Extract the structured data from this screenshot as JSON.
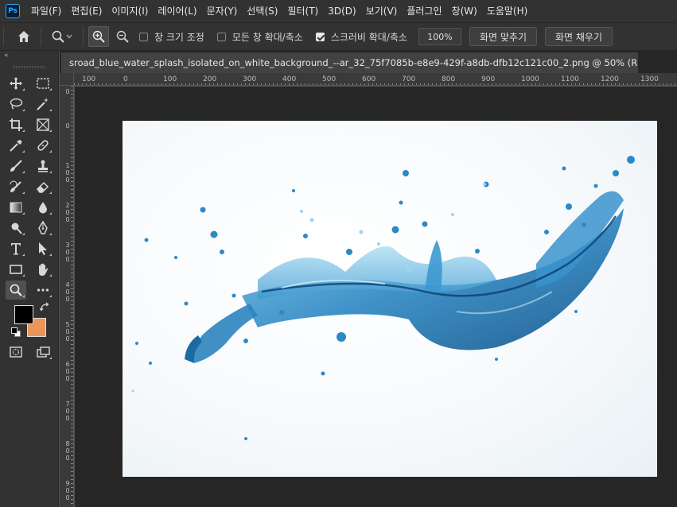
{
  "app": {
    "logo": "Ps"
  },
  "menu": [
    "파일(F)",
    "편집(E)",
    "이미지(I)",
    "레이어(L)",
    "문자(Y)",
    "선택(S)",
    "필터(T)",
    "3D(D)",
    "보기(V)",
    "플러그인",
    "창(W)",
    "도움말(H)"
  ],
  "options": {
    "resize_windows_label": "창 크기 조정",
    "resize_windows_checked": false,
    "zoom_all_label": "모든 창 확대/축소",
    "zoom_all_checked": false,
    "scrubby_zoom_label": "스크러비 확대/축소",
    "scrubby_zoom_checked": true,
    "zoom_value": "100%",
    "fit_screen_label": "화면 맞추기",
    "fill_screen_label": "화면 채우기"
  },
  "document": {
    "tab_title": "sroad_blue_water_splash_isolated_on_white_background_--ar_32_75f7085b-e8e9-429f-a8db-dfb12c121c00_2.png @ 50% (RGB/8#)",
    "close_glyph": "×"
  },
  "rulers": {
    "horizontal": [
      "100",
      "0",
      "100",
      "200",
      "300",
      "400",
      "500",
      "600",
      "700",
      "800",
      "900",
      "1000",
      "1100",
      "1200",
      "1300"
    ],
    "vertical": [
      "0",
      "0",
      "100",
      "200",
      "300",
      "400",
      "500",
      "600",
      "700",
      "800",
      "900"
    ]
  },
  "toolbox": {
    "collapse_glyph": "«",
    "tools": [
      [
        "move-icon",
        "marquee-icon"
      ],
      [
        "lasso-icon",
        "magic-wand-icon"
      ],
      [
        "crop-icon",
        "frame-icon"
      ],
      [
        "eyedropper-icon",
        "healing-brush-icon"
      ],
      [
        "brush-icon",
        "clone-stamp-icon"
      ],
      [
        "history-brush-icon",
        "eraser-icon"
      ],
      [
        "gradient-icon",
        "blur-icon"
      ],
      [
        "dodge-icon",
        "pen-icon"
      ],
      [
        "type-icon",
        "path-select-icon"
      ],
      [
        "rectangle-icon",
        "hand-icon"
      ],
      [
        "zoom-icon",
        "more-tools-icon"
      ]
    ],
    "active_tool": "zoom-icon"
  },
  "colors": {
    "foreground": "#000000",
    "background": "#e9955c",
    "accent": "#31a8ff"
  }
}
